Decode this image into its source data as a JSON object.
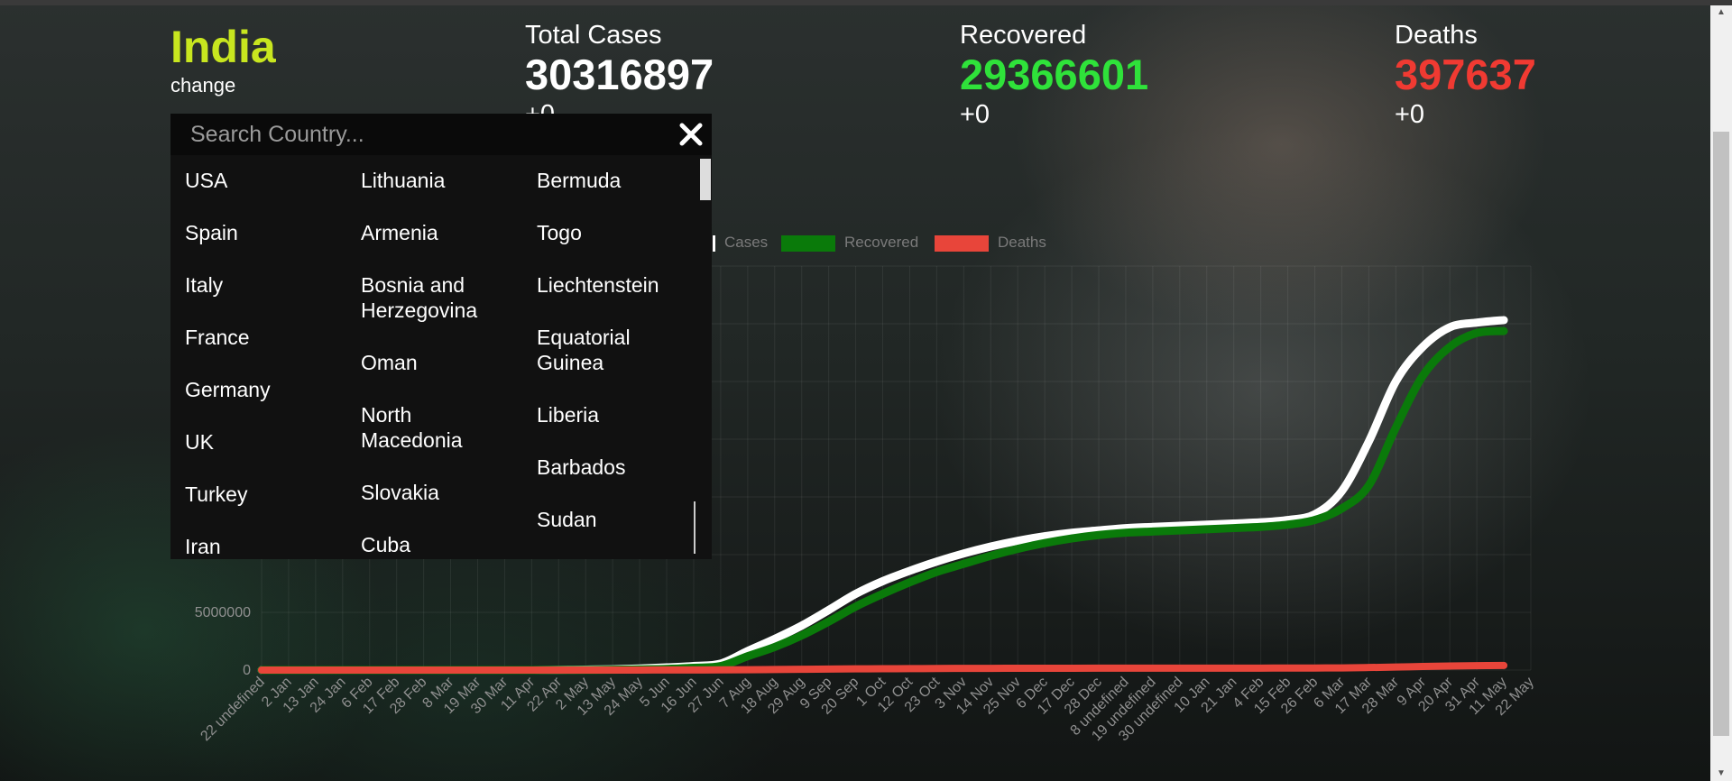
{
  "country": {
    "name": "India",
    "change_label": "change"
  },
  "stats": {
    "total_cases": {
      "label": "Total Cases",
      "value": "30316897",
      "delta": "+0"
    },
    "recovered": {
      "label": "Recovered",
      "value": "29366601",
      "delta": "+0"
    },
    "deaths": {
      "label": "Deaths",
      "value": "397637",
      "delta": "+0"
    }
  },
  "dropdown": {
    "placeholder": "Search Country...",
    "columns": [
      [
        "USA",
        "Spain",
        "Italy",
        "France",
        "Germany",
        "UK",
        "Turkey",
        "Iran"
      ],
      [
        "Lithuania",
        "Armenia",
        "Bosnia and\nHerzegovina",
        "Oman",
        "North\nMacedonia",
        "Slovakia",
        "Cuba"
      ],
      [
        "Bermuda",
        "Togo",
        "Liechtenstein",
        "Equatorial\nGuinea",
        "Liberia",
        "Barbados",
        "Sudan"
      ]
    ]
  },
  "colors": {
    "country_name": "#c8e61f",
    "recovered": "#2fe23a",
    "deaths": "#f03a32",
    "cases_line": "#ffffff",
    "recovered_line": "#0a7a0a",
    "deaths_line": "#e8453a"
  },
  "chart_data": {
    "type": "line",
    "legend": [
      "Cases",
      "Recovered",
      "Deaths"
    ],
    "y_ticks": [
      "0",
      "5000000"
    ],
    "x_tick_labels": [
      "22 undefined",
      "2 Jan",
      "13 Jan",
      "24 Jan",
      "6 Feb",
      "17 Feb",
      "28 Feb",
      "8 Mar",
      "19 Mar",
      "30 Mar",
      "11 Apr",
      "22 Apr",
      "2 May",
      "13 May",
      "24 May",
      "5 Jun",
      "16 Jun",
      "27 Jun",
      "7 Aug",
      "18 Aug",
      "29 Aug",
      "9 Sep",
      "20 Sep",
      "1 Oct",
      "12 Oct",
      "23 Oct",
      "3 Nov",
      "14 Nov",
      "25 Nov",
      "6 Dec",
      "17 Dec",
      "28 Dec",
      "8 undefined",
      "19 undefined",
      "30 undefined",
      "10 Jan",
      "21 Jan",
      "4 Feb",
      "15 Feb",
      "26 Feb",
      "6 Mar",
      "17 Mar",
      "28 Mar",
      "9 Apr",
      "20 Apr",
      "31 Apr",
      "11 May",
      "22 May"
    ],
    "ylim": [
      0,
      35000000
    ],
    "series": [
      {
        "name": "Cases",
        "values": [
          0,
          0,
          0,
          0,
          0,
          0,
          0,
          0,
          0,
          0,
          1000,
          20000,
          40000,
          70000,
          140000,
          230000,
          350000,
          560000,
          1650000,
          2700000,
          3850000,
          5200000,
          6600000,
          7700000,
          8600000,
          9400000,
          10100000,
          10700000,
          11200000,
          11600000,
          11900000,
          12100000,
          12300000,
          12400000,
          12500000,
          12600000,
          12700000,
          12800000,
          13000000,
          13500000,
          15500000,
          19800000,
          25000000,
          28000000,
          29700000,
          30100000,
          30316897
        ]
      },
      {
        "name": "Recovered",
        "values": [
          0,
          0,
          0,
          0,
          0,
          0,
          0,
          0,
          0,
          0,
          0,
          5000,
          12000,
          25000,
          60000,
          100000,
          200000,
          350000,
          1200000,
          2000000,
          3000000,
          4200000,
          5500000,
          6600000,
          7600000,
          8500000,
          9200000,
          9900000,
          10500000,
          11000000,
          11400000,
          11700000,
          11900000,
          12000000,
          12100000,
          12200000,
          12300000,
          12400000,
          12600000,
          13000000,
          14000000,
          16000000,
          21000000,
          25500000,
          28000000,
          29200000,
          29366601
        ]
      },
      {
        "name": "Deaths",
        "values": [
          0,
          0,
          0,
          0,
          0,
          0,
          0,
          0,
          0,
          0,
          30,
          300,
          1000,
          3000,
          4500,
          8000,
          12000,
          18000,
          30000,
          50000,
          70000,
          90000,
          105000,
          115000,
          125000,
          135000,
          145000,
          150000,
          155000,
          158000,
          160000,
          162000,
          164000,
          165000,
          166000,
          167000,
          168000,
          170000,
          175000,
          180000,
          190000,
          220000,
          260000,
          310000,
          350000,
          380000,
          397637
        ]
      }
    ]
  }
}
